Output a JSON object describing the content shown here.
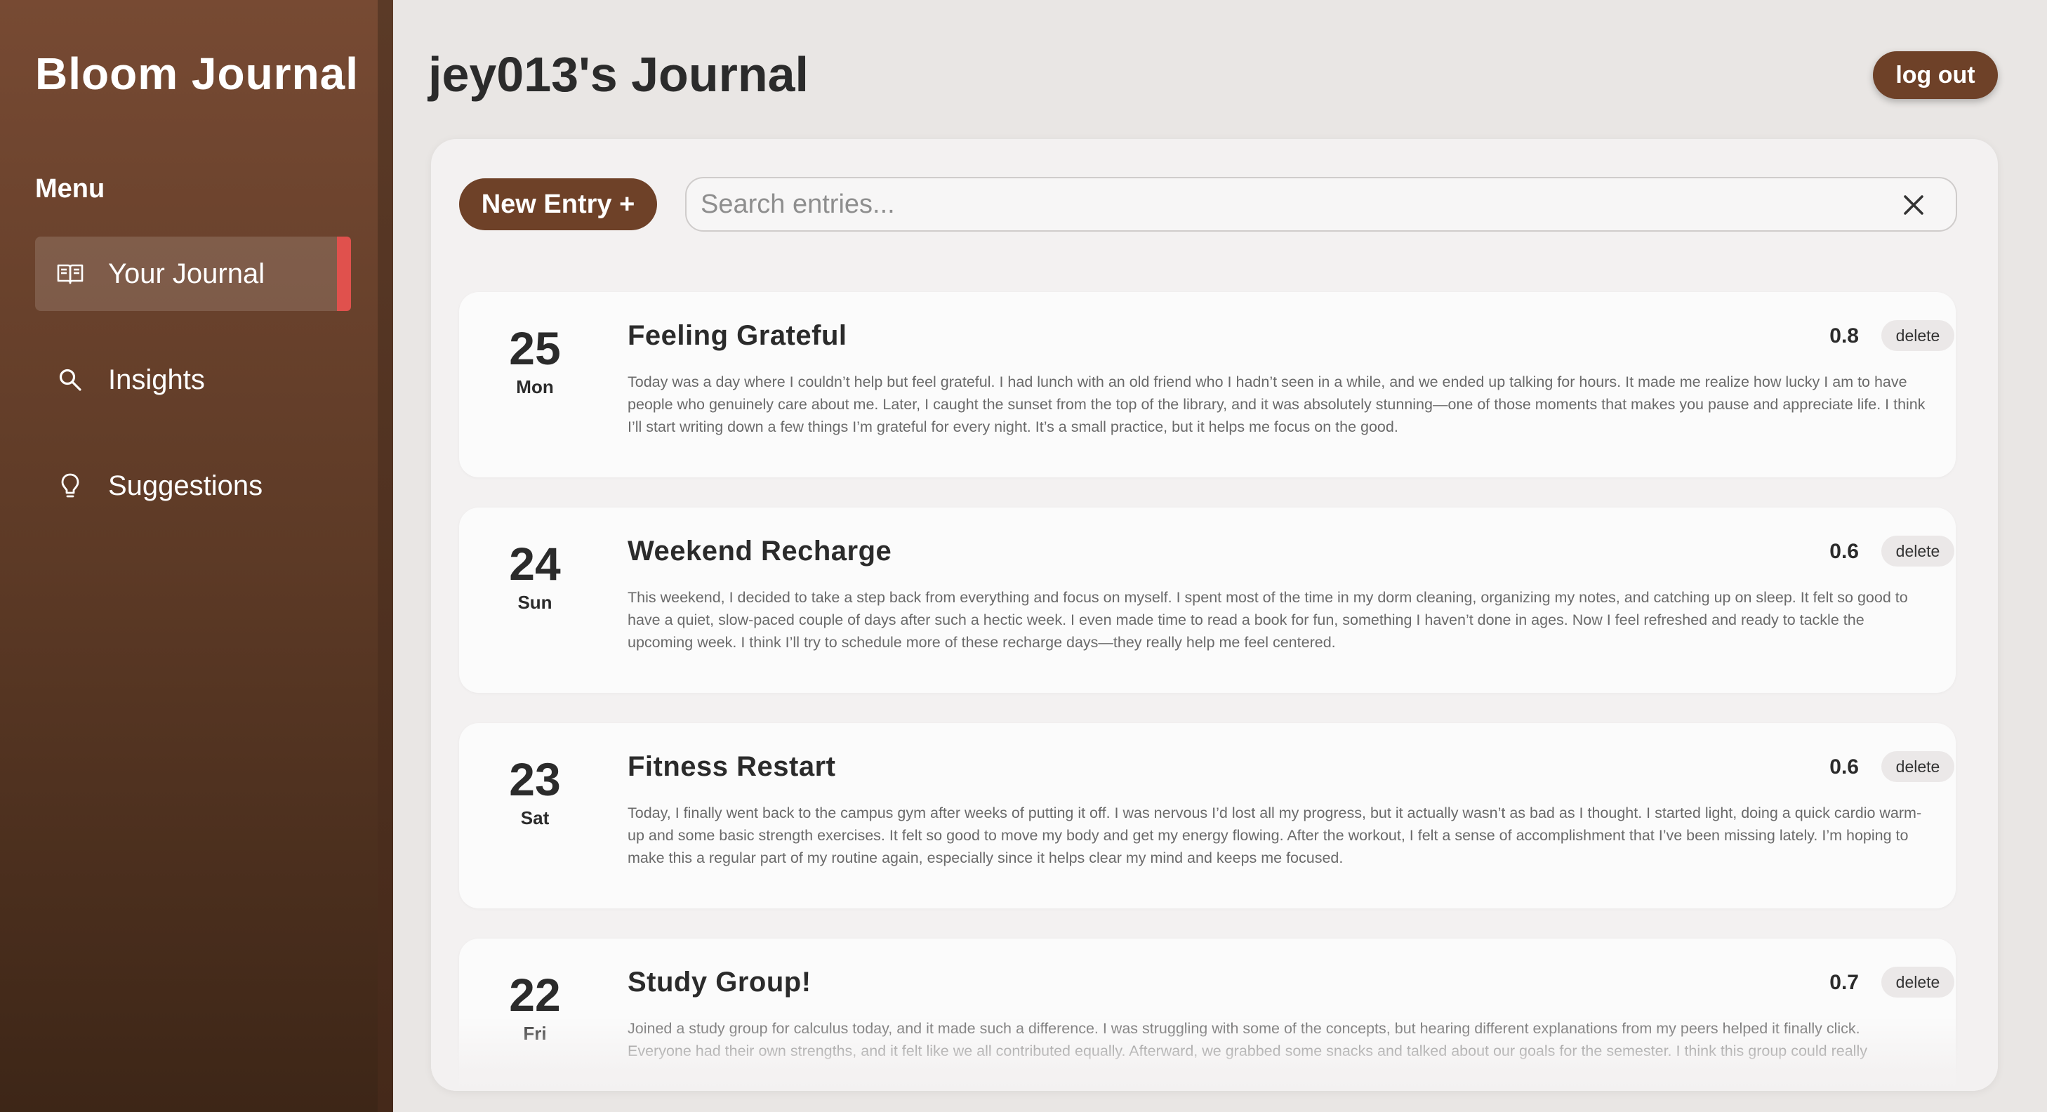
{
  "sidebar": {
    "brand": "Bloom Journal",
    "menu_heading": "Menu",
    "items": [
      {
        "label": "Your Journal",
        "icon": "book-open-icon",
        "active": true
      },
      {
        "label": "Insights",
        "icon": "search-icon",
        "active": false
      },
      {
        "label": "Suggestions",
        "icon": "lightbulb-icon",
        "active": false
      }
    ]
  },
  "header": {
    "title": "jey013's Journal",
    "logout_label": "log out"
  },
  "toolbar": {
    "new_entry_label": "New Entry +",
    "search_placeholder": "Search entries...",
    "search_value": "",
    "clear_icon": "close-icon"
  },
  "entries": [
    {
      "day": "25",
      "weekday": "Mon",
      "title": "Feeling Grateful",
      "score": "0.8",
      "delete_label": "delete",
      "body": "Today was a day where I couldn’t help but feel grateful. I had lunch with an old friend who I hadn’t seen in a while, and we ended up talking for hours. It made me realize how lucky I am to have people who genuinely care about me. Later, I caught the sunset from the top of the library, and it was absolutely stunning—one of those moments that makes you pause and appreciate life. I think I’ll start writing down a few things I’m grateful for every night. It’s a small practice, but it helps me focus on the good."
    },
    {
      "day": "24",
      "weekday": "Sun",
      "title": "Weekend Recharge",
      "score": "0.6",
      "delete_label": "delete",
      "body": "This weekend, I decided to take a step back from everything and focus on myself. I spent most of the time in my dorm cleaning, organizing my notes, and catching up on sleep. It felt so good to have a quiet, slow-paced couple of days after such a hectic week. I even made time to read a book for fun, something I haven’t done in ages. Now I feel refreshed and ready to tackle the upcoming week. I think I’ll try to schedule more of these recharge days—they really help me feel centered."
    },
    {
      "day": "23",
      "weekday": "Sat",
      "title": "Fitness Restart",
      "score": "0.6",
      "delete_label": "delete",
      "body": "Today, I finally went back to the campus gym after weeks of putting it off. I was nervous I’d lost all my progress, but it actually wasn’t as bad as I thought. I started light, doing a quick cardio warm-up and some basic strength exercises. It felt so good to move my body and get my energy flowing. After the workout, I felt a sense of accomplishment that I’ve been missing lately. I’m hoping to make this a regular part of my routine again, especially since it helps clear my mind and keeps me focused."
    },
    {
      "day": "22",
      "weekday": "Fri",
      "title": "Study Group!",
      "score": "0.7",
      "delete_label": "delete",
      "body": "Joined a study group for calculus today, and it made such a difference. I was struggling with some of the concepts, but hearing different explanations from my peers helped it finally click. Everyone had their own strengths, and it felt like we all contributed equally. Afterward, we grabbed some snacks and talked about our goals for the semester. I think this group could really"
    }
  ]
}
